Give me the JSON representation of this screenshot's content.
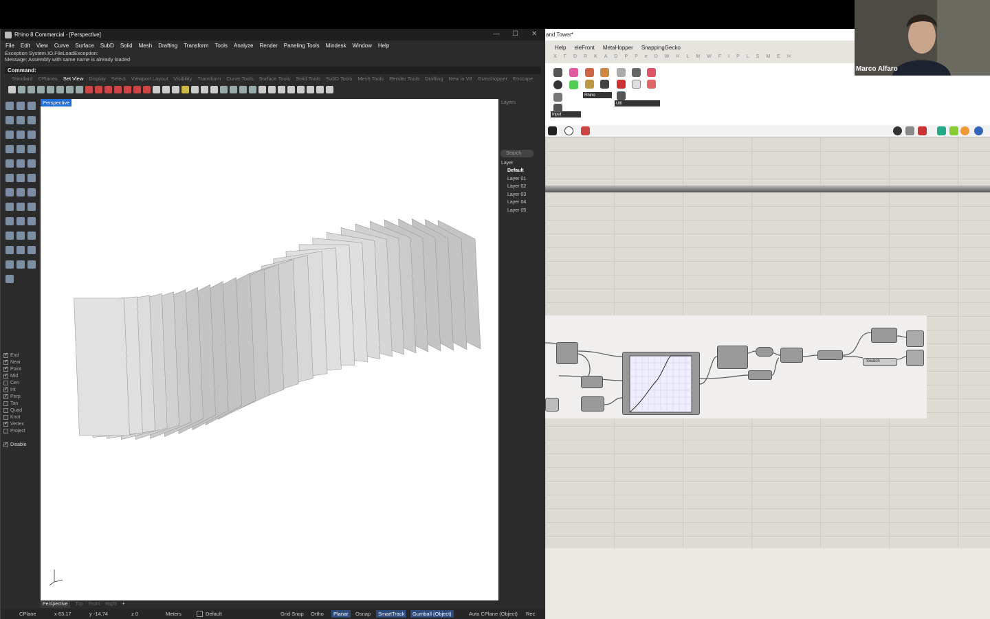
{
  "rhino": {
    "title": "Rhino 8 Commercial - [Perspective]",
    "menu": [
      "File",
      "Edit",
      "View",
      "Curve",
      "Surface",
      "SubD",
      "Solid",
      "Mesh",
      "Drafting",
      "Transform",
      "Tools",
      "Analyze",
      "Render",
      "Paneling Tools",
      "Mindesk",
      "Window",
      "Help"
    ],
    "history": [
      "Exception System.IO.FileLoadException:",
      "Message: Assembly with same name is already loaded"
    ],
    "command_label": "Command:",
    "tabs": [
      "Standard",
      "CPlanes",
      "Set View",
      "Display",
      "Select",
      "Viewport Layout",
      "Visibility",
      "Transform",
      "Curve Tools",
      "Surface Tools",
      "Solid Tools",
      "SubD Tools",
      "Mesh Tools",
      "Render Tools",
      "Drafting",
      "New in V8",
      "Grasshopper",
      "Enscape"
    ],
    "active_tab": "Set View",
    "viewport_label": "Perspective",
    "layers_panel": {
      "title": "Layers",
      "search": "Search",
      "header": "Layer",
      "items": [
        "Default",
        "Layer 01",
        "Layer 02",
        "Layer 03",
        "Layer 04",
        "Layer 05"
      ]
    },
    "osnaps": [
      {
        "label": "End",
        "on": true
      },
      {
        "label": "Near",
        "on": true
      },
      {
        "label": "Point",
        "on": true
      },
      {
        "label": "Mid",
        "on": true
      },
      {
        "label": "Cen",
        "on": false
      },
      {
        "label": "Int",
        "on": true
      },
      {
        "label": "Perp",
        "on": true
      },
      {
        "label": "Tan",
        "on": false
      },
      {
        "label": "Quad",
        "on": false
      },
      {
        "label": "Knot",
        "on": false
      },
      {
        "label": "Vertex",
        "on": true
      },
      {
        "label": "Project",
        "on": false
      }
    ],
    "disable_label": "Disable",
    "view_tabs": [
      "Perspective",
      "Top",
      "Front",
      "Right"
    ],
    "status": {
      "cplane": "CPlane",
      "x": "x 63.17",
      "y": "y -14.74",
      "z": "z 0",
      "units": "Meters",
      "layer": "Default",
      "grid_snap": "Grid Snap",
      "ortho": "Ortho",
      "planar": "Planar",
      "osnap": "Osnap",
      "smarttrack": "SmartTrack",
      "gumball": "Gumball (Object)",
      "auto_cplane": "Auto CPlane (Object)",
      "record": "Rec"
    }
  },
  "grasshopper": {
    "title": "and Tower*",
    "menu": [
      "Help",
      "eleFront",
      "MetaHopper",
      "SnappingGecko"
    ],
    "categories": [
      "X",
      "T",
      "D",
      "R",
      "K",
      "A",
      "D",
      "P",
      "P",
      "e",
      "D",
      "W",
      "H",
      "L",
      "M",
      "W",
      "F",
      "I",
      "P",
      "L",
      "S",
      "M",
      "E",
      "H"
    ],
    "groups": [
      "Input",
      "Rhino",
      "Util"
    ],
    "swatch_label": "Swatch"
  },
  "webcam": {
    "name": "Marco Alfaro"
  }
}
